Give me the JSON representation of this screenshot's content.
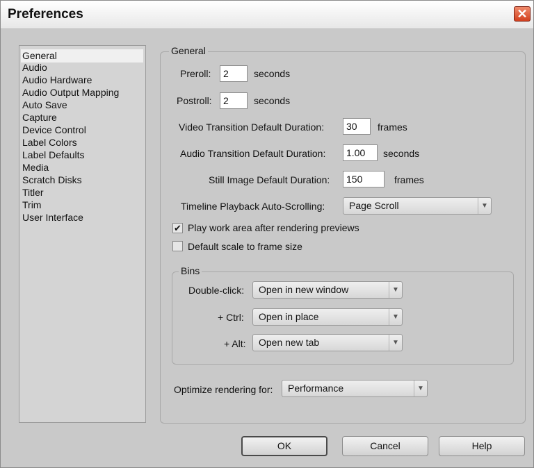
{
  "window": {
    "title": "Preferences",
    "close_glyph": "✕"
  },
  "categories": [
    {
      "label": "General",
      "selected": true
    },
    {
      "label": "Audio"
    },
    {
      "label": "Audio Hardware"
    },
    {
      "label": "Audio Output Mapping"
    },
    {
      "label": "Auto Save"
    },
    {
      "label": "Capture"
    },
    {
      "label": "Device Control"
    },
    {
      "label": "Label Colors"
    },
    {
      "label": "Label Defaults"
    },
    {
      "label": "Media"
    },
    {
      "label": "Scratch Disks"
    },
    {
      "label": "Titler"
    },
    {
      "label": "Trim"
    },
    {
      "label": "User Interface"
    }
  ],
  "general": {
    "legend": "General",
    "preroll": {
      "label": "Preroll:",
      "value": "2",
      "unit": "seconds"
    },
    "postroll": {
      "label": "Postroll:",
      "value": "2",
      "unit": "seconds"
    },
    "video_transition": {
      "label": "Video Transition Default Duration:",
      "value": "30",
      "unit": "frames"
    },
    "audio_transition": {
      "label": "Audio Transition Default Duration:",
      "value": "1.00",
      "unit": "seconds"
    },
    "still_image": {
      "label": "Still Image Default Duration:",
      "value": "150",
      "unit": "frames"
    },
    "autoscroll": {
      "label": "Timeline Playback Auto-Scrolling:",
      "value": "Page Scroll"
    },
    "play_work_area": {
      "label": "Play work area after rendering previews",
      "checked": true
    },
    "default_scale": {
      "label": "Default scale to frame size",
      "checked": false
    },
    "bins": {
      "legend": "Bins",
      "double_click": {
        "label": "Double-click:",
        "value": "Open in new window"
      },
      "ctrl": {
        "label": "+ Ctrl:",
        "value": "Open in place"
      },
      "alt": {
        "label": "+ Alt:",
        "value": "Open new tab"
      }
    },
    "optimize": {
      "label": "Optimize rendering for:",
      "value": "Performance"
    }
  },
  "buttons": {
    "ok": "OK",
    "cancel": "Cancel",
    "help": "Help"
  },
  "icons": {
    "dropdown": "▼",
    "check": "✔"
  }
}
